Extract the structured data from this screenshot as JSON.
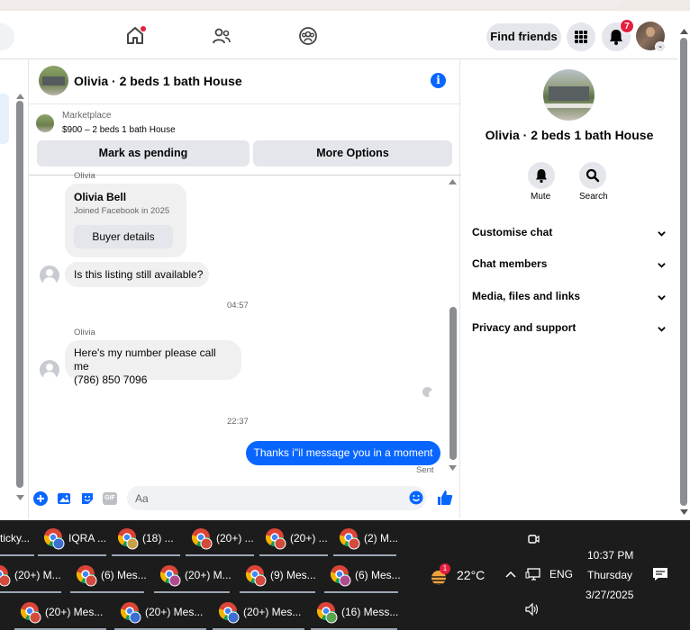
{
  "header": {
    "find_friends": "Find friends",
    "notification_count": "7"
  },
  "chat": {
    "title": "Olivia · 2 beds 1 bath House",
    "marketplace_label": "Marketplace",
    "listing_price_title": "$900 – 2 beds 1 bath House",
    "mark_pending": "Mark as pending",
    "more_options": "More Options",
    "messages": {
      "sender_top": "Olivia",
      "profile_name": "Olivia Bell",
      "profile_joined": "Joined Facebook in 2025",
      "buyer_details": "Buyer details",
      "m1": "Is this listing still available?",
      "t1": "04:57",
      "sender2": "Olivia",
      "m2_line1": "Here's my number please call me",
      "m2_line2": "(786) 850 7096",
      "t2": "22:37",
      "outgoing": "Thanks i\"il message you in a moment",
      "status": "Sent"
    },
    "composer_placeholder": "Aa"
  },
  "info_panel": {
    "title": "Olivia · 2 beds 1 bath House",
    "mute": "Mute",
    "search": "Search",
    "sections": [
      "Customise chat",
      "Chat members",
      "Media, files and links",
      "Privacy and support"
    ]
  },
  "taskbar": {
    "row1": [
      "ticky...",
      "IQRA ...",
      "(18) ...",
      "(20+) ...",
      "(20+) ...",
      "(2) M..."
    ],
    "row2": [
      "(20+) M...",
      "(6) Mes...",
      "(20+) M...",
      "(9) Mes...",
      "(6) Mes..."
    ],
    "row3": [
      "(20+) Mes...",
      "(20+) Mes...",
      "(20+) Mes...",
      "(16) Mess..."
    ],
    "weather_badge": "1",
    "temperature": "22°C",
    "language": "ENG",
    "time": "10:37 PM",
    "day": "Thursday",
    "date": "3/27/2025"
  }
}
